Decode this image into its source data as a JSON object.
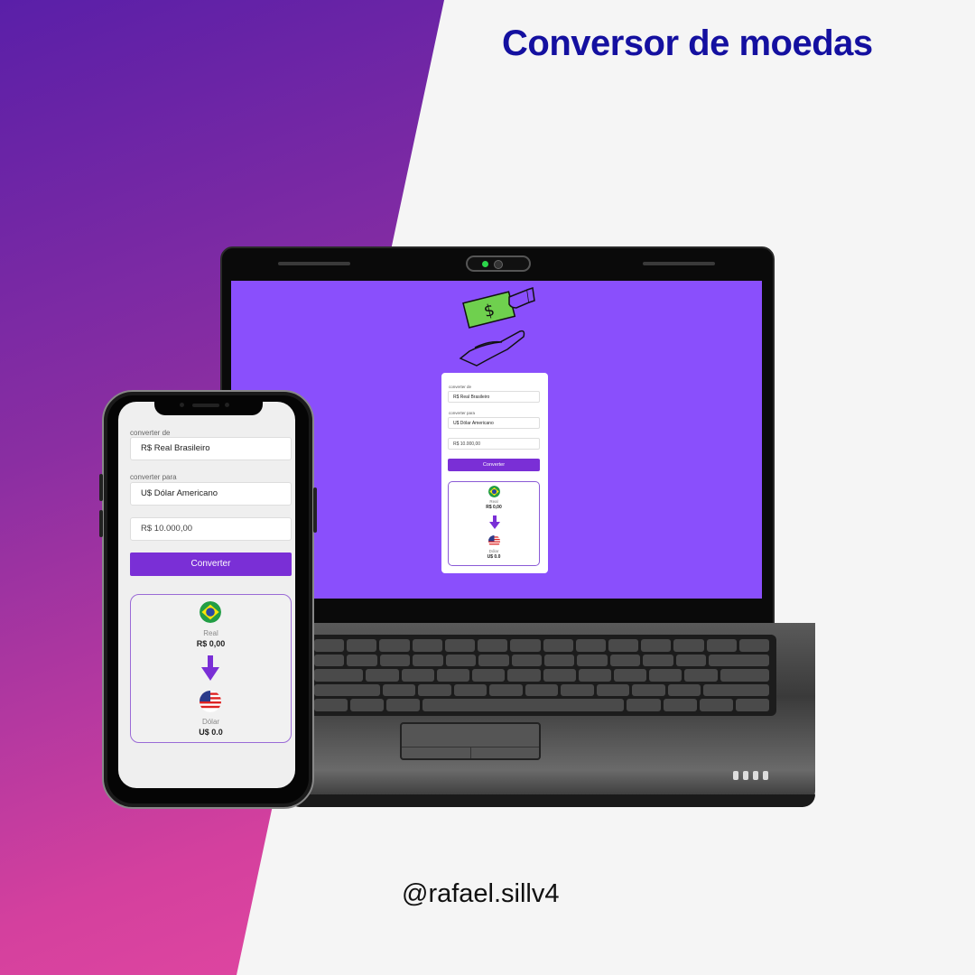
{
  "header": {
    "title": "Conversor de moedas"
  },
  "footer": {
    "handle": "@rafael.sillv4"
  },
  "app": {
    "from_label": "converter de",
    "from_value": "R$ Real Brasileiro",
    "to_label": "converter para",
    "to_value": "U$ Dólar Americano",
    "amount_value": "R$ 10.000,00",
    "convert_button": "Converter",
    "result": {
      "source_name": "Real",
      "source_amount": "R$ 0,00",
      "target_name": "Dólar",
      "target_amount": "U$ 0.0"
    },
    "money_symbol": "$"
  },
  "colors": {
    "accent": "#7a2fd6",
    "screen_bg": "#8a4ffc",
    "title": "#1410a0"
  },
  "icons": [
    "money-hand-icon",
    "brazil-flag-icon",
    "usa-flag-icon",
    "arrow-down-icon"
  ]
}
